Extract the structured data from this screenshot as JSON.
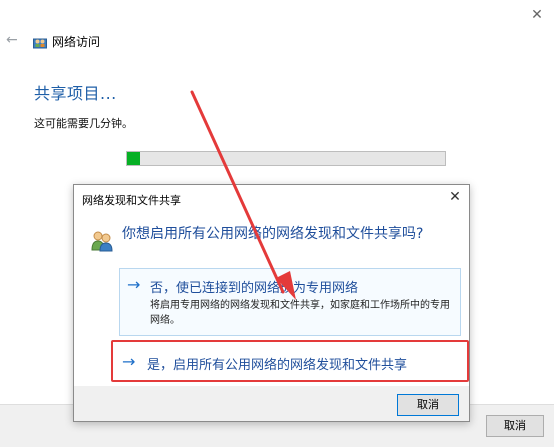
{
  "window": {
    "title": "网络访问",
    "heading": "共享项目...",
    "subtext": "这可能需要几分钟。",
    "progress": 0.04,
    "progress_color": "#06b025",
    "cancel_label": "取消"
  },
  "dialog": {
    "title": "网络发现和文件共享",
    "question": "你想启用所有公用网络的网络发现和文件共享吗?",
    "options": [
      {
        "arrow": "→",
        "title": "否，使已连接到的网络成为专用网络",
        "description": "将启用专用网络的网络发现和文件共享，如家庭和工作场所中的专用网络。"
      },
      {
        "arrow": "→",
        "title": "是，启用所有公用网络的网络发现和文件共享"
      }
    ],
    "cancel_label": "取消"
  },
  "icons": {
    "back": "back-arrow-icon",
    "network": "network-users-icon",
    "close": "close-icon"
  },
  "colors": {
    "accent": "#1f4e9b",
    "highlight": "#e43a3a"
  }
}
